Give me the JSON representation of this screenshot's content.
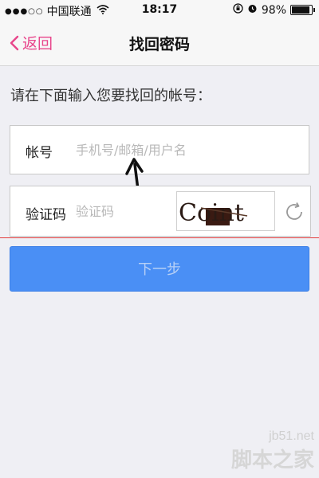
{
  "status_bar": {
    "carrier": "中国联通",
    "time": "18:17",
    "battery": "98%",
    "battery_level": 0.98
  },
  "nav": {
    "back_label": "返回",
    "title": "找回密码"
  },
  "prompt": "请在下面输入您要找回的帐号：",
  "account_field": {
    "label": "帐号",
    "placeholder": "手机号/邮箱/用户名"
  },
  "verify_field": {
    "label": "验证码",
    "placeholder": "验证码"
  },
  "captcha": {
    "text": "Coint"
  },
  "next_button": "下一步",
  "watermark": {
    "url": "jb51.net",
    "text": "脚本之家"
  },
  "colors": {
    "accent": "#e8468b",
    "primary_button": "#4a8ff5",
    "divider": "#e23b3b"
  }
}
